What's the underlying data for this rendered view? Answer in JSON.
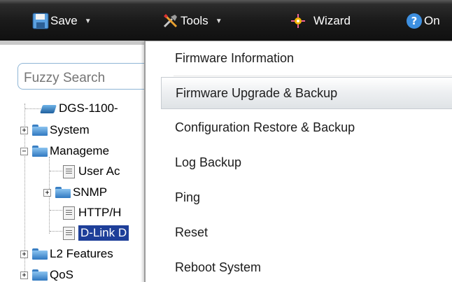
{
  "toolbar": {
    "save_label": "Save",
    "tools_label": "Tools",
    "wizard_label": "Wizard",
    "online_label": "On"
  },
  "icons": {
    "save": "floppy-disk-icon",
    "tools": "tools-icon",
    "wizard": "wizard-icon",
    "help": "help-circle-icon"
  },
  "colors": {
    "toolbar_bg": "#1a1a1a",
    "selected_bg": "#1e3f99",
    "search_border": "#8fb6d6"
  },
  "search": {
    "placeholder": "Fuzzy Search"
  },
  "tree": {
    "device": "DGS-1100-",
    "system": "System",
    "management": "Manageme",
    "user_accounts": "User Ac",
    "snmp": "SNMP",
    "http": "HTTP/H",
    "dlink": "D-Link D",
    "l2": "L2 Features",
    "qos": "QoS"
  },
  "tools_menu": {
    "items": [
      "Firmware Information",
      "Firmware Upgrade & Backup",
      "Configuration Restore & Backup",
      "Log Backup",
      "Ping",
      "Reset",
      "Reboot System"
    ]
  }
}
